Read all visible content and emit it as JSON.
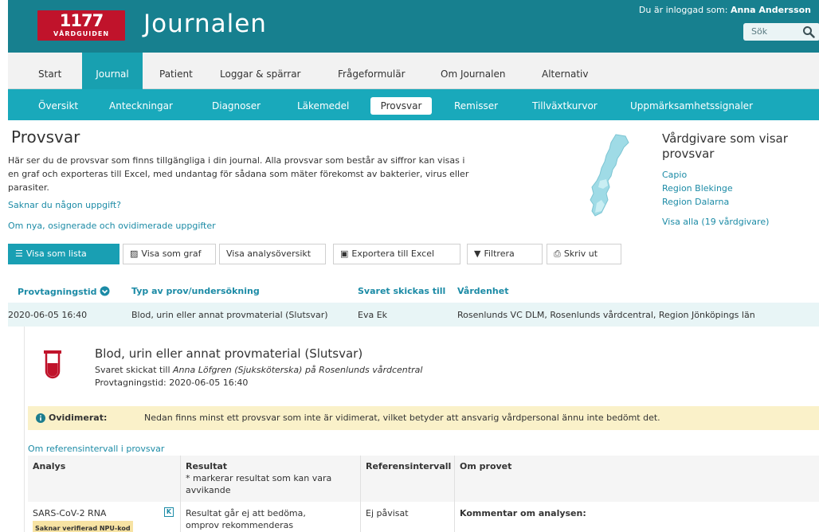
{
  "header": {
    "logo_number": "1177",
    "logo_text": "VÅRDGUIDEN",
    "app_title": "Journalen",
    "logged_in_prefix": "Du är inloggad som:",
    "user_name": "Anna Andersson",
    "search_label": "Sök"
  },
  "nav_main": [
    "Start",
    "Journal",
    "Patient",
    "Loggar & spärrar",
    "Frågeformulär",
    "Om Journalen",
    "Alternativ"
  ],
  "nav_sub": [
    "Översikt",
    "Anteckningar",
    "Diagnoser",
    "Läkemedel",
    "Provsvar",
    "Remisser",
    "Tillväxtkurvor",
    "Uppmärksamhetssignaler"
  ],
  "page": {
    "title": "Provsvar",
    "intro": "Här ser du de provsvar som finns tillgängliga i din journal. Alla provsvar som består av siffror kan visas i en graf och exporteras till Excel, med undantag för sådana som mäter förekomst av bakterier, virus eller parasiter.",
    "missing_link": "Saknar du någon uppgift?",
    "new_data_link": "Om nya, osignerade och ovidimerade uppgifter"
  },
  "providers": {
    "title": "Vårdgivare som visar provsvar",
    "items": [
      "Capio",
      "Region Blekinge",
      "Region Dalarna"
    ],
    "show_all": "Visa alla (19 vårdgivare)"
  },
  "toolbar": {
    "list": "Visa som lista",
    "graph": "Visa som graf",
    "analysis": "Visa analysöversikt",
    "excel": "Exportera till Excel",
    "filter": "Filtrera",
    "print": "Skriv ut"
  },
  "table": {
    "headers": [
      "Provtagningstid",
      "Typ av prov/undersökning",
      "Svaret skickas till",
      "Vårdenhet"
    ],
    "row": {
      "time": "2020-06-05 16:40",
      "type": "Blod, urin eller annat provmaterial (Slutsvar)",
      "sent_to": "Eva Ek",
      "unit": "Rosenlunds VC DLM, Rosenlunds vårdcentral, Region Jönköpings län"
    }
  },
  "detail": {
    "title": "Blod, urin eller annat provmaterial (Slutsvar)",
    "sent_prefix": "Svaret skickat till",
    "sent_person": "Anna Löfgren (Sjuksköterska)",
    "sent_mid": "på",
    "sent_place": "Rosenlunds vårdcentral",
    "date_label": "Provtagningstid:",
    "date_value": "2020-06-05 16:40",
    "warning_label": "Ovidimerat:",
    "warning_text": "Nedan finns minst ett provsvar som inte är vidimerat, vilket betyder att ansvarig vårdpersonal ännu inte bedömt det.",
    "ref_link": "Om referensintervall i provsvar",
    "result_headers": {
      "analys": "Analys",
      "resultat": "Resultat",
      "resultat_sub": "* markerar resultat som kan vara avvikande",
      "ref": "Referensintervall",
      "om": "Om provet"
    },
    "result_row": {
      "analys": "SARS-CoV-2 RNA",
      "badge": "Saknar verifierad NPU-kod",
      "k": "K",
      "resultat": "Resultat går ej att bedöma, omprov rekommenderas",
      "ref": "Ej påvisat",
      "om": "Kommentar om analysen:"
    }
  },
  "colors": {
    "header_bg": "#17808f",
    "logo_red": "#c0132b",
    "active_teal": "#199fb3",
    "warning_bg": "#faf1c9"
  }
}
